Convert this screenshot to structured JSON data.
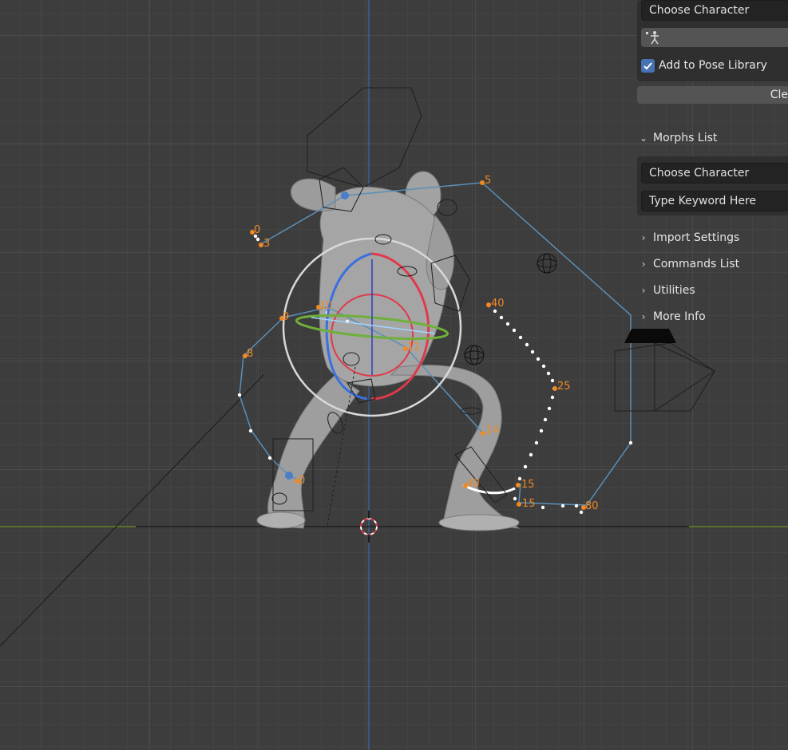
{
  "panel": {
    "character_dropdown_top": "Choose Character",
    "add_to_pose_library_label": "Add to Pose Library",
    "add_to_pose_library_checked": true,
    "clear_button_label": "Cle",
    "morphs_section_label": "Morphs List",
    "morphs_character_dropdown": "Choose Character",
    "morphs_keyword_placeholder": "Type Keyword Here",
    "sections": [
      {
        "label": "Import Settings"
      },
      {
        "label": "Commands List"
      },
      {
        "label": "Utilities"
      },
      {
        "label": "More Info"
      }
    ]
  },
  "viewport": {
    "frame_labels": [
      "0",
      "3",
      "5",
      "9",
      "10",
      "8",
      "11",
      "40",
      "25",
      "14",
      "40",
      "15",
      "15",
      "80",
      "0"
    ],
    "colors": {
      "background": "#3d3d3d",
      "grid": "#4a4a4a",
      "motion_path": "#5a8fb8",
      "frame_number": "#f08a24",
      "accent_blue": "#4772b3",
      "rotate_x": "#e03a4a",
      "rotate_y": "#6fb03a",
      "rotate_z": "#3a6fe0"
    }
  }
}
